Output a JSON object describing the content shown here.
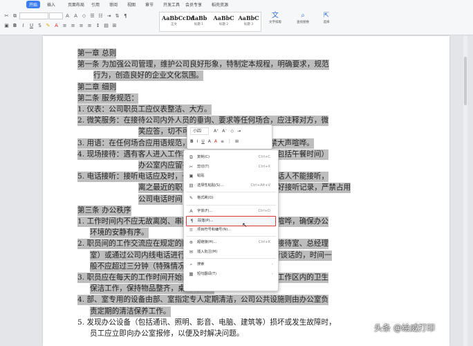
{
  "ribbon": {
    "tabs": [
      "",
      "开始",
      "插入",
      "页面布局",
      "引用",
      "审阅",
      "视图",
      "章节",
      "开发工具",
      "会员专享",
      "稻壳资源"
    ],
    "active_tab": "开始",
    "styles": [
      {
        "preview": "AaBbCcDd",
        "label": "正文"
      },
      {
        "preview": "AaBb",
        "label": "标题 1"
      },
      {
        "preview": "AaBbC",
        "label": "标题 2"
      },
      {
        "preview": "AaBbC",
        "label": "标题 3"
      }
    ],
    "right_tools": [
      {
        "icon": "文",
        "label": "文字排版"
      },
      {
        "icon": "⌕",
        "label": "查找替换"
      },
      {
        "icon": "⇱",
        "label": "选择"
      }
    ]
  },
  "document": {
    "lines": [
      {
        "text": "第一章  总则",
        "hl": true
      },
      {
        "text": "第一条  为加强公司管理，维护公司良好形象，特制定本规程，明确要求，规范",
        "hl": true
      },
      {
        "text": "行为，创造良好的企业文化氛围。",
        "hl": true
      },
      {
        "text": "第二章  细则",
        "hl": true
      },
      {
        "text": "第二条  服务规范：",
        "hl": true
      },
      {
        "text": "1. 仪表：公司职员工应仪表整洁、大方。",
        "hl": true
      },
      {
        "text": "2. 微笑服务：在接待公司内外人员的垂询、要求等任何场合，应注释对方，微",
        "hl": true
      },
      {
        "text": "笑应答，切不可",
        "hl": true
      },
      {
        "text": "3. 用语：在任何场合应用语规范，语气温和，音量适中，严禁大声喧哗。",
        "hl": true
      },
      {
        "text": "4. 现场接待：遇有客人进入工作场地应礼貌询问，必要时间（包括午餐时间）",
        "hl": true
      },
      {
        "text": "办公室内应留有人员值守。",
        "hl": true
      },
      {
        "text": "5. 电话接听：接听电话应及时，一般电话不应超过三声，如受话人不能接听，",
        "hl": true
      },
      {
        "text": "离之最近的职员应代为接听，重要电话要做好接听记录，严禁占用",
        "hl": true
      },
      {
        "text": "公司电话时间",
        "hl": true
      },
      {
        "text": "第三条  办公秩序",
        "hl": true
      },
      {
        "text": "1. 工作时间内不应无故离岗、串岗，不得闲聊、吃零食、大声喧哗，确保办公",
        "hl": true
      },
      {
        "text": "环境的安静有序。",
        "hl": true
      },
      {
        "text": "2. 职员间的工作交流应在规定的区域内进行（大厅、会议室、接待室、总经理",
        "hl": true
      },
      {
        "text": "室）或通过公司内线电话进行，如需在个人工作区域内进行谈话的，时间一",
        "hl": true
      },
      {
        "text": "般不应超过三分钟（特殊情况除外）。",
        "hl": true
      },
      {
        "text": "3. 职员应在每天的工作时间开始前和工作时间结束后做好个人工作区内的卫生",
        "hl": true
      },
      {
        "text": "保洁工作，保持物品整齐，桌面清洁。",
        "hl": true
      },
      {
        "text": "4. 部、室专用的设备由部、室指定专人定期清洁，公司公共设施则由办公室负",
        "hl": true
      },
      {
        "text": "责定期的清洁保养工作。",
        "hl": true
      },
      {
        "text": "5. 发现办公设备（包括通讯、照明、影音、电脑、建筑等）损坏或发生故障时，",
        "hl": false
      },
      {
        "text": "员工应立即向办公室报修，以便及时解决问题。",
        "hl": false
      }
    ]
  },
  "mini_toolbar": {
    "font": "小四",
    "row1": [
      "A⁺",
      "A⁻",
      "◇",
      "⇥"
    ],
    "row2": [
      "B",
      "I",
      "U",
      "A",
      "A",
      "≡",
      "⋮",
      "⊞"
    ]
  },
  "context_menu": {
    "items": [
      {
        "icon": "⧉",
        "label": "复制(C)",
        "shortcut": "Ctrl+C",
        "arrow": false,
        "selected": false
      },
      {
        "icon": "✂",
        "label": "剪切(T)",
        "shortcut": "Ctrl+X",
        "arrow": false,
        "selected": false
      },
      {
        "icon": "▣",
        "label": "粘贴",
        "shortcut": "",
        "arrow": false,
        "selected": false
      },
      {
        "icon": "▤",
        "label": "选择性粘贴(S)...",
        "shortcut": "Ctrl+Alt+V",
        "arrow": false,
        "selected": false
      },
      {
        "icon": "✎",
        "label": "格式刷(O)",
        "shortcut": "",
        "arrow": false,
        "selected": false
      },
      {
        "icon": "A",
        "label": "字体(F)...",
        "shortcut": "Ctrl+D",
        "arrow": false,
        "selected": false
      },
      {
        "icon": "¶",
        "label": "段落(P)...",
        "shortcut": "",
        "arrow": false,
        "selected": true
      },
      {
        "icon": "≡",
        "label": "项目符号和编号(N)...",
        "shortcut": "",
        "arrow": false,
        "selected": false
      },
      {
        "icon": "⊕",
        "label": "超链接(H)...",
        "shortcut": "Ctrl+K",
        "arrow": false,
        "selected": false
      },
      {
        "icon": "✉",
        "label": "插入批注(M)",
        "shortcut": "",
        "arrow": false,
        "selected": false
      },
      {
        "icon": "⌕",
        "label": "搜索",
        "shortcut": "",
        "arrow": true,
        "selected": false
      },
      {
        "icon": "▦",
        "label": "短句翻译(T)",
        "shortcut": "",
        "arrow": true,
        "selected": false
      }
    ]
  },
  "watermark": "头条 @绘威打印"
}
